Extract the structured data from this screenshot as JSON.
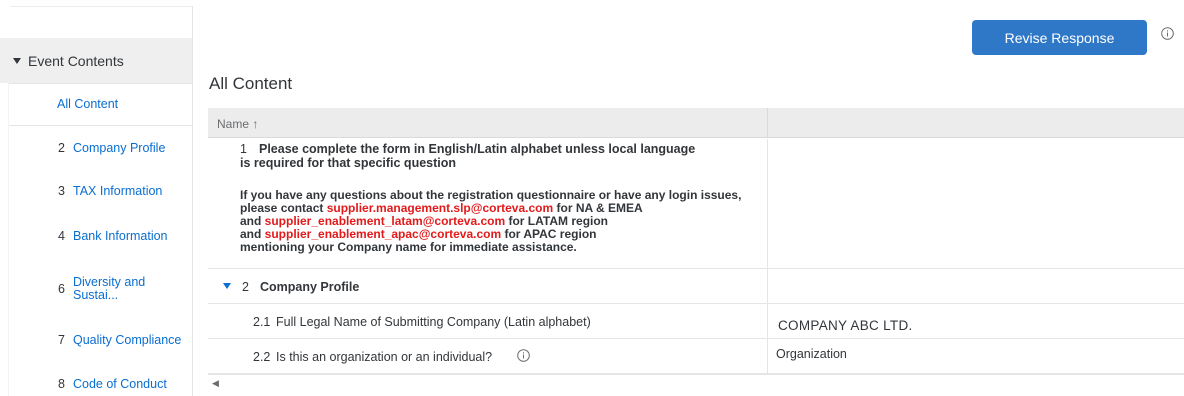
{
  "sidebar": {
    "header": "Event Contents",
    "items": [
      {
        "num": "",
        "label": "All Content"
      },
      {
        "num": "2",
        "label": "Company Profile"
      },
      {
        "num": "3",
        "label": "TAX Information"
      },
      {
        "num": "4",
        "label": "Bank Information"
      },
      {
        "num": "6",
        "label_line1": "Diversity and",
        "label_line2": "Sustai..."
      },
      {
        "num": "7",
        "label": "Quality Compliance"
      },
      {
        "num": "8",
        "label": "Code of Conduct"
      }
    ]
  },
  "header": {
    "revise_button": "Revise Response"
  },
  "main": {
    "title": "All Content",
    "table": {
      "column_name": "Name ↑",
      "row1": {
        "num": "1",
        "title_line1": "Please complete the form in English/Latin alphabet unless local language",
        "title_line2": "is required for that specific question",
        "note_line1": "If you have any questions about the registration questionnaire or have any login issues,",
        "note_l2_pre": "please contact ",
        "note_l2_email": "supplier.management.slp@corteva.com",
        "note_l2_post": " for NA & EMEA",
        "note_l3_pre": "and ",
        "note_l3_email": "supplier_enablement_latam@corteva.com",
        "note_l3_post": " for LATAM region",
        "note_l4_pre": "and ",
        "note_l4_email": "supplier_enablement_apac@corteva.com",
        "note_l4_post": " for APAC region",
        "note_line5": "mentioning your Company name for immediate assistance."
      },
      "row2": {
        "num": "2",
        "label": "Company Profile"
      },
      "row3": {
        "num": "2.1",
        "label": "Full Legal Name of Submitting Company (Latin alphabet)",
        "value": "COMPANY ABC LTD."
      },
      "row4": {
        "num": "2.2",
        "label": "Is this an organization or an individual?",
        "value": "Organization"
      }
    }
  },
  "icons": {
    "info": "info-icon",
    "expand": "triangle-down-icon",
    "scroll_left": "arrow-left-icon"
  },
  "colors": {
    "accent": "#0a6ed1",
    "button": "#2f78c8",
    "email": "#e21a1a"
  }
}
